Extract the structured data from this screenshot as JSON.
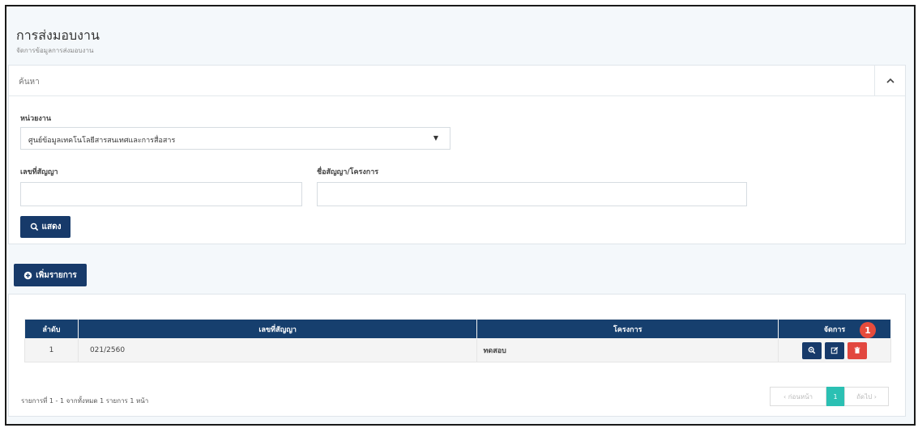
{
  "page": {
    "title": "การส่งมอบงาน",
    "subtitle": "จัดการข้อมูลการส่งมอบงาน"
  },
  "search": {
    "header": "ค้นหา",
    "agency_label": "หน่วยงาน",
    "agency_value": "ศูนย์ข้อมูลเทคโนโลยีสารสนเทศและการสื่อสาร",
    "contract_label": "เลขที่สัญญา",
    "contract_value": "",
    "project_label": "ชื่อสัญญา/โครงการ",
    "project_value": "",
    "show_button": "แสดง"
  },
  "toolbar": {
    "add_button": "เพิ่มรายการ"
  },
  "table": {
    "headers": [
      "ลำดับ",
      "เลขที่สัญญา",
      "โครงการ",
      "จัดการ"
    ],
    "rows": [
      {
        "no": "1",
        "contract": "021/2560",
        "project": "ทดสอบ"
      }
    ]
  },
  "annotation": "1",
  "footer": {
    "summary": "รายการที่ 1 - 1 จากทั้งหมด 1 รายการ 1 หน้า",
    "prev": "‹ ก่อนหน้า",
    "current_page": "1",
    "next": "ถัดไป ›"
  },
  "colors": {
    "primary": "#173a6a",
    "header": "#163f6e",
    "danger": "#e2473f",
    "accent": "#2bc0b3"
  },
  "icons": {
    "collapse": "chevron-up-icon",
    "show": "search-icon",
    "add": "plus-circle-icon",
    "view": "zoom-icon",
    "edit": "edit-icon",
    "delete": "trash-icon"
  }
}
